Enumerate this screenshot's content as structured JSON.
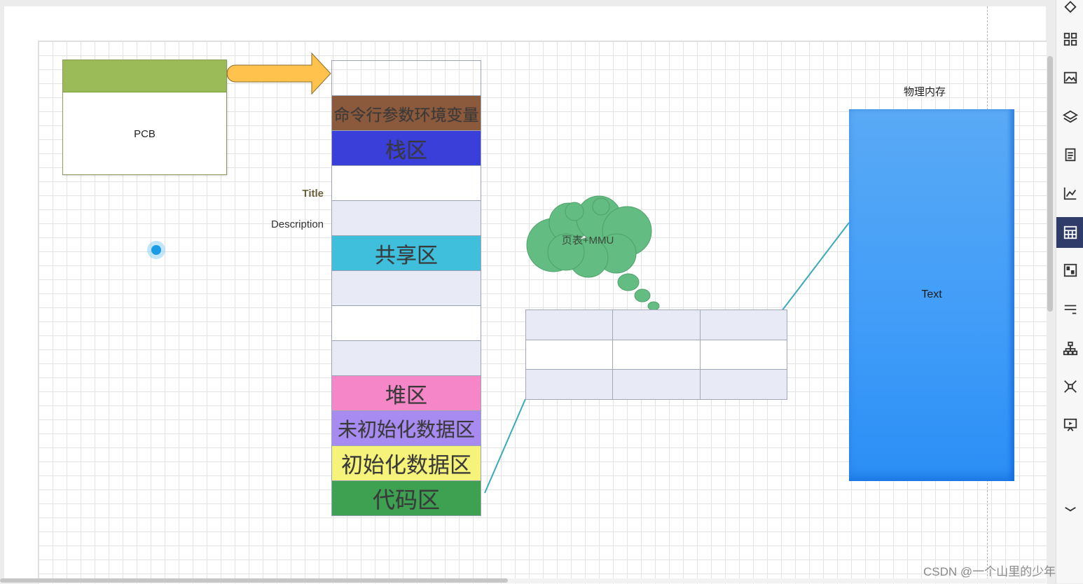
{
  "diagram": {
    "pcb": {
      "label": "PCB"
    },
    "side_panel": {
      "title": "Title",
      "description": "Description"
    },
    "segments": [
      {
        "label": "",
        "color": "#ffffff"
      },
      {
        "label": "命令行参数环境变量",
        "color": "#8b5a3c"
      },
      {
        "label": "栈区",
        "color": "#3a3fd9"
      },
      {
        "label": "",
        "color": "#ffffff"
      },
      {
        "label": "",
        "color": "#e8ebf5"
      },
      {
        "label": "共享区",
        "color": "#3fbfdc"
      },
      {
        "label": "",
        "color": "#e8ebf5"
      },
      {
        "label": "",
        "color": "#ffffff"
      },
      {
        "label": "",
        "color": "#e8ebf5"
      },
      {
        "label": "堆区",
        "color": "#f587c8"
      },
      {
        "label": "未初始化数据区",
        "color": "#a78bf0"
      },
      {
        "label": "初始化数据区",
        "color": "#f6f37a"
      },
      {
        "label": "代码区",
        "color": "#3ea152"
      }
    ],
    "cloud": {
      "label": "页表+MMU",
      "color": "#63bd82"
    },
    "page_table": {
      "rows": 3,
      "cols": 3
    },
    "physical_memory": {
      "title": "物理内存",
      "label": "Text",
      "color": "#3f9cf8"
    },
    "arrows": {
      "pcb_arrow_color": "#ffc34d",
      "stack_arrow_color": "#3440d6",
      "heap_arrow_color": "#f48ac8",
      "line_color": "#3aaabb"
    }
  },
  "toolbar": {
    "tools": [
      {
        "name": "shapes-tool-icon"
      },
      {
        "name": "grid-apps-icon"
      },
      {
        "name": "image-icon"
      },
      {
        "name": "layers-icon"
      },
      {
        "name": "document-icon"
      },
      {
        "name": "chart-icon"
      },
      {
        "name": "table-icon",
        "active": true
      },
      {
        "name": "layout-icon"
      },
      {
        "name": "format-icon"
      },
      {
        "name": "tree-icon"
      },
      {
        "name": "connection-icon"
      },
      {
        "name": "presentation-icon"
      },
      {
        "name": "collapse-icon"
      }
    ]
  },
  "watermark": "CSDN @一个山里的少年"
}
